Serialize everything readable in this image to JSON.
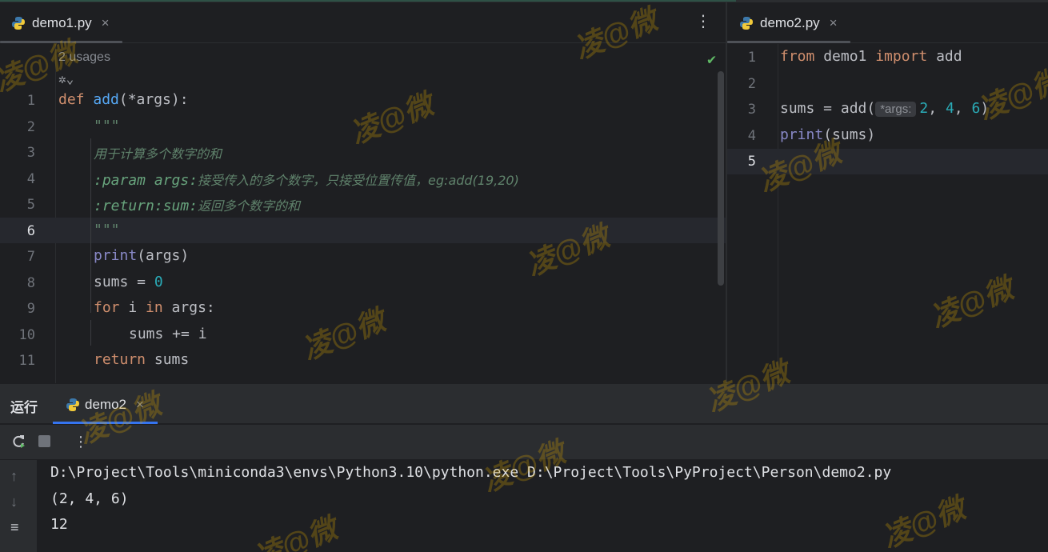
{
  "editor_left": {
    "tab": {
      "label": "demo1.py",
      "close": "×"
    },
    "menu": "⋮",
    "inlay": {
      "usages": "2 usages"
    },
    "lines": [
      {
        "num": "1"
      },
      {
        "num": "2"
      },
      {
        "num": "3"
      },
      {
        "num": "4"
      },
      {
        "num": "5"
      },
      {
        "num": "6"
      },
      {
        "num": "7"
      },
      {
        "num": "8"
      },
      {
        "num": "9"
      },
      {
        "num": "10"
      },
      {
        "num": "11"
      }
    ],
    "code": {
      "l1": {
        "kw": "def",
        "fn": "add",
        "rest": "(*args):"
      },
      "l2": "\"\"\"",
      "l3": "用于计算多个数字的和",
      "l4": {
        "tag": ":param args:",
        "text": "接受传入的多个数字，只接受位置传值，eg:add(19,20)"
      },
      "l5": {
        "tag": ":return:sum:",
        "text": "返回多个数字的和"
      },
      "l6": "\"\"\"",
      "l7": {
        "fn": "print",
        "rest": "(args)"
      },
      "l8": {
        "lhs": "sums = ",
        "num": "0"
      },
      "l9": {
        "kw1": "for",
        "mid": " i ",
        "kw2": "in",
        "rest": " args:"
      },
      "l10": "sums += i",
      "l11": {
        "kw": "return",
        "rest": " sums"
      }
    }
  },
  "editor_right": {
    "tab": {
      "label": "demo2.py",
      "close": "×"
    },
    "lines": [
      {
        "num": "1"
      },
      {
        "num": "2"
      },
      {
        "num": "3"
      },
      {
        "num": "4"
      },
      {
        "num": "5"
      }
    ],
    "code": {
      "l1": {
        "kw1": "from",
        "mod": " demo1 ",
        "kw2": "import",
        "name": " add"
      },
      "l3": {
        "lhs": "sums = add(",
        "hint": "*args:",
        "a": "2",
        "b": "4",
        "c": "6",
        "comma": ", ",
        "close": ")"
      },
      "l4": {
        "fn": "print",
        "rest": "(sums)"
      }
    }
  },
  "run_panel": {
    "title": "运行",
    "tab": {
      "label": "demo2",
      "close": "×"
    },
    "menu": "⋮",
    "output": [
      "D:\\Project\\Tools\\miniconda3\\envs\\Python3.10\\python.exe D:\\Project\\Tools\\PyProject\\Person\\demo2.py",
      "(2, 4, 6)",
      "12"
    ]
  },
  "watermark": "凌@微",
  "colors": {
    "keyword": "#cf8e6d",
    "function": "#56a8f5",
    "number": "#2aacb8",
    "docstring": "#5f826b",
    "accent": "#3574f0"
  }
}
